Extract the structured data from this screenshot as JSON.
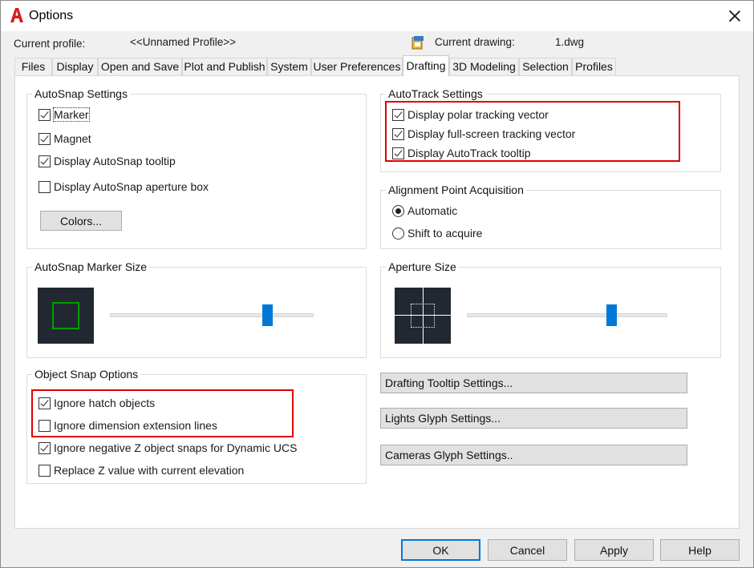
{
  "window": {
    "title": "Options",
    "app_icon": "autocad-a-icon",
    "close_icon": "close-icon"
  },
  "profile": {
    "label": "Current profile:",
    "value": "<<Unnamed Profile>>"
  },
  "drawing": {
    "icon": "drawing-file-icon",
    "label": "Current drawing:",
    "value": "1.dwg"
  },
  "tabs": [
    {
      "label": "Files"
    },
    {
      "label": "Display"
    },
    {
      "label": "Open and Save"
    },
    {
      "label": "Plot and Publish"
    },
    {
      "label": "System"
    },
    {
      "label": "User Preferences"
    },
    {
      "label": "Drafting"
    },
    {
      "label": "3D Modeling"
    },
    {
      "label": "Selection"
    },
    {
      "label": "Profiles"
    }
  ],
  "active_tab": "Drafting",
  "autosnap": {
    "title": "AutoSnap Settings",
    "items": [
      {
        "label": "Marker",
        "checked": true
      },
      {
        "label": "Magnet",
        "checked": true
      },
      {
        "label": "Display AutoSnap tooltip",
        "checked": true
      },
      {
        "label": "Display AutoSnap aperture box",
        "checked": false
      }
    ],
    "colors_button": "Colors..."
  },
  "autotrack": {
    "title": "AutoTrack Settings",
    "items": [
      {
        "label": "Display polar tracking vector",
        "checked": true
      },
      {
        "label": "Display full-screen tracking vector",
        "checked": true
      },
      {
        "label": "Display AutoTrack tooltip",
        "checked": true
      }
    ]
  },
  "alignment": {
    "title": "Alignment Point Acquisition",
    "options": [
      {
        "label": "Automatic",
        "selected": true
      },
      {
        "label": "Shift to acquire",
        "selected": false
      }
    ]
  },
  "marker_size": {
    "title": "AutoSnap Marker Size",
    "slider_value": 0.77,
    "preview_color": "#00a000"
  },
  "aperture_size": {
    "title": "Aperture Size",
    "slider_value": 0.72
  },
  "object_snap": {
    "title": "Object Snap Options",
    "items": [
      {
        "label": "Ignore hatch objects",
        "checked": true
      },
      {
        "label": "Ignore dimension extension lines",
        "checked": false
      },
      {
        "label": "Ignore negative Z object snaps for Dynamic UCS",
        "checked": true
      },
      {
        "label": "Replace Z value with current elevation",
        "checked": false
      }
    ]
  },
  "side_buttons": {
    "drafting_tooltip": "Drafting Tooltip Settings...",
    "lights_glyph": "Lights Glyph Settings...",
    "cameras_glyph": "Cameras Glyph Settings.."
  },
  "footer": {
    "ok": "OK",
    "cancel": "Cancel",
    "apply": "Apply",
    "help": "Help"
  },
  "colors": {
    "accent": "#0078d7",
    "highlight": "#e00000",
    "preview_bg": "#222831"
  }
}
